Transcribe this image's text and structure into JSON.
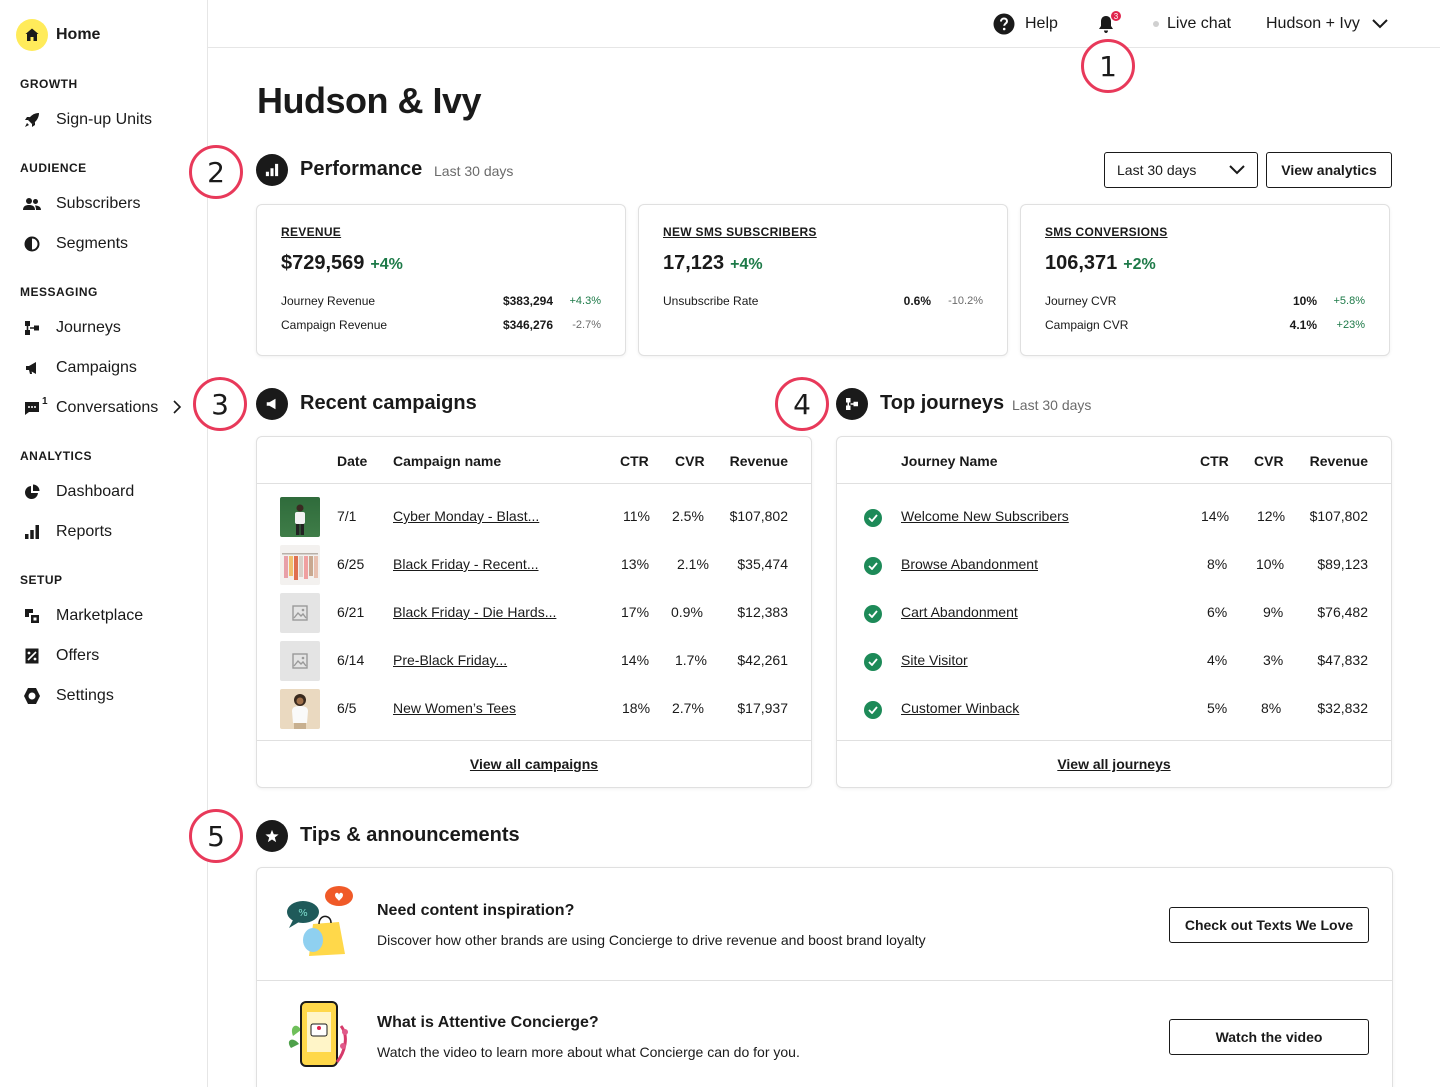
{
  "sidebar": {
    "home": "Home",
    "sections": [
      {
        "title": "GROWTH",
        "items": [
          {
            "label": "Sign-up Units",
            "icon": "rocket-icon"
          }
        ]
      },
      {
        "title": "AUDIENCE",
        "items": [
          {
            "label": "Subscribers",
            "icon": "people-icon"
          },
          {
            "label": "Segments",
            "icon": "segments-icon"
          }
        ]
      },
      {
        "title": "MESSAGING",
        "items": [
          {
            "label": "Journeys",
            "icon": "journeys-icon"
          },
          {
            "label": "Campaigns",
            "icon": "megaphone-icon"
          },
          {
            "label": "Conversations",
            "icon": "chat-icon",
            "count": "1"
          }
        ]
      },
      {
        "title": "ANALYTICS",
        "items": [
          {
            "label": "Dashboard",
            "icon": "pie-icon"
          },
          {
            "label": "Reports",
            "icon": "bar-chart-icon"
          }
        ]
      },
      {
        "title": "SETUP",
        "items": [
          {
            "label": "Marketplace",
            "icon": "marketplace-icon"
          },
          {
            "label": "Offers",
            "icon": "offers-icon"
          },
          {
            "label": "Settings",
            "icon": "settings-icon"
          }
        ]
      }
    ]
  },
  "topbar": {
    "help": "Help",
    "notifications": "3",
    "live_chat": "Live chat",
    "account": "Hudson + Ivy"
  },
  "annotations": [
    "1",
    "2",
    "3",
    "4",
    "5"
  ],
  "page_title": "Hudson & Ivy",
  "performance": {
    "title": "Performance",
    "subtitle": "Last 30 days",
    "range_select": "Last 30 days",
    "analytics_button": "View analytics",
    "cards": [
      {
        "label": "REVENUE",
        "value": "$729,569",
        "delta": "+4%",
        "rows": [
          {
            "label": "Journey Revenue",
            "value": "$383,294",
            "change": "+4.3%",
            "positive": true
          },
          {
            "label": "Campaign Revenue",
            "value": "$346,276",
            "change": "-2.7%",
            "positive": false
          }
        ]
      },
      {
        "label": "NEW SMS SUBSCRIBERS",
        "value": "17,123",
        "delta": "+4%",
        "rows": [
          {
            "label": "Unsubscribe Rate",
            "value": "0.6%",
            "change": "-10.2%",
            "positive": false
          }
        ]
      },
      {
        "label": "SMS CONVERSIONS",
        "value": "106,371",
        "delta": "+2%",
        "rows": [
          {
            "label": "Journey CVR",
            "value": "10%",
            "change": "+5.8%",
            "positive": true
          },
          {
            "label": "Campaign CVR",
            "value": "4.1%",
            "change": "+23%",
            "positive": true
          }
        ]
      }
    ]
  },
  "campaigns": {
    "title": "Recent campaigns",
    "headers": {
      "date": "Date",
      "name": "Campaign name",
      "ctr": "CTR",
      "cvr": "CVR",
      "revenue": "Revenue"
    },
    "rows": [
      {
        "date": "7/1",
        "name": "Cyber Monday - Blast...",
        "ctr": "11%",
        "cvr": "2.5%",
        "revenue": "$107,802",
        "thumb": "photo-man-green"
      },
      {
        "date": "6/25",
        "name": "Black Friday - Recent...",
        "ctr": "13%",
        "cvr": "2.1%",
        "revenue": "$35,474",
        "thumb": "photo-clothes-rack"
      },
      {
        "date": "6/21",
        "name": "Black Friday - Die Hards...",
        "ctr": "17%",
        "cvr": "0.9%",
        "revenue": "$12,383",
        "thumb": "image-placeholder"
      },
      {
        "date": "6/14",
        "name": "Pre-Black Friday...",
        "ctr": "14%",
        "cvr": "1.7%",
        "revenue": "$42,261",
        "thumb": "image-placeholder"
      },
      {
        "date": "6/5",
        "name": "New Women’s Tees",
        "ctr": "18%",
        "cvr": "2.7%",
        "revenue": "$17,937",
        "thumb": "photo-woman-tee"
      }
    ],
    "footer": "View all campaigns"
  },
  "journeys": {
    "title": "Top journeys",
    "subtitle": "Last 30 days",
    "headers": {
      "name": "Journey Name",
      "ctr": "CTR",
      "cvr": "CVR",
      "revenue": "Revenue"
    },
    "rows": [
      {
        "name": "Welcome New Subscribers",
        "ctr": "14%",
        "cvr": "12%",
        "revenue": "$107,802"
      },
      {
        "name": "Browse Abandonment",
        "ctr": "8%",
        "cvr": "10%",
        "revenue": "$89,123"
      },
      {
        "name": "Cart Abandonment",
        "ctr": "6%",
        "cvr": "9%",
        "revenue": "$76,482"
      },
      {
        "name": "Site Visitor",
        "ctr": "4%",
        "cvr": "3%",
        "revenue": "$47,832"
      },
      {
        "name": "Customer Winback",
        "ctr": "5%",
        "cvr": "8%",
        "revenue": "$32,832"
      }
    ],
    "footer": "View all journeys"
  },
  "tips": {
    "title": "Tips & announcements",
    "items": [
      {
        "title": "Need content inspiration?",
        "desc": "Discover how other brands are using Concierge to drive revenue and boost brand loyalty",
        "button": "Check out Texts We Love"
      },
      {
        "title": "What is Attentive Concierge?",
        "desc": "Watch the video to learn more about what Concierge can do for you.",
        "button": "Watch the video"
      }
    ]
  },
  "colors": {
    "brand_yellow": "#ffeb5a",
    "positive": "#1d7a48",
    "annotation": "#e8395a",
    "check": "#1d8a58"
  }
}
